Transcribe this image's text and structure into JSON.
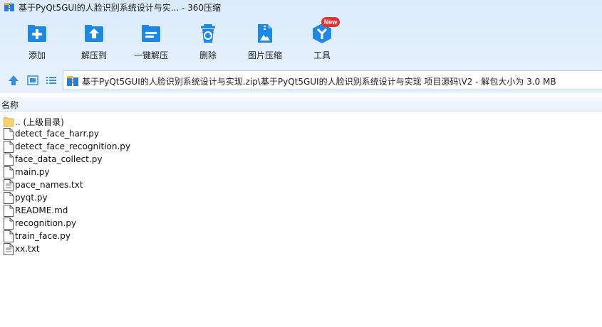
{
  "window": {
    "title": "基于PyQt5GUI的人脸识别系统设计与实... - 360压缩",
    "app_icon": "archive-app-icon"
  },
  "toolbar": {
    "items": [
      {
        "label": "添加",
        "icon": "add-icon"
      },
      {
        "label": "解压到",
        "icon": "extract-to-icon"
      },
      {
        "label": "一键解压",
        "icon": "one-click-extract-icon"
      },
      {
        "label": "删除",
        "icon": "trash-icon"
      },
      {
        "label": "图片压缩",
        "icon": "image-compress-icon"
      },
      {
        "label": "工具",
        "icon": "tools-icon",
        "badge": "New"
      }
    ]
  },
  "address_bar": {
    "path": "基于PyQt5GUI的人脸识别系统设计与实现.zip\\基于PyQt5GUI的人脸识别系统设计与实现 项目源码\\V2 - 解包大小为 3.0 MB"
  },
  "columns": {
    "name": "名称"
  },
  "files": [
    {
      "name": ".. (上级目录)",
      "type": "folder"
    },
    {
      "name": "detect_face_harr.py",
      "type": "file"
    },
    {
      "name": "detect_face_recognition.py",
      "type": "file"
    },
    {
      "name": "face_data_collect.py",
      "type": "file"
    },
    {
      "name": "main.py",
      "type": "file"
    },
    {
      "name": "pace_names.txt",
      "type": "text"
    },
    {
      "name": "pyqt.py",
      "type": "file"
    },
    {
      "name": "README.md",
      "type": "file"
    },
    {
      "name": "recognition.py",
      "type": "file"
    },
    {
      "name": "train_face.py",
      "type": "file"
    },
    {
      "name": "xx.txt",
      "type": "text"
    }
  ],
  "colors": {
    "accent": "#1e88e5",
    "chrome": "#e3effc",
    "badge": "#e8312f",
    "folder": "#f7d46b"
  }
}
